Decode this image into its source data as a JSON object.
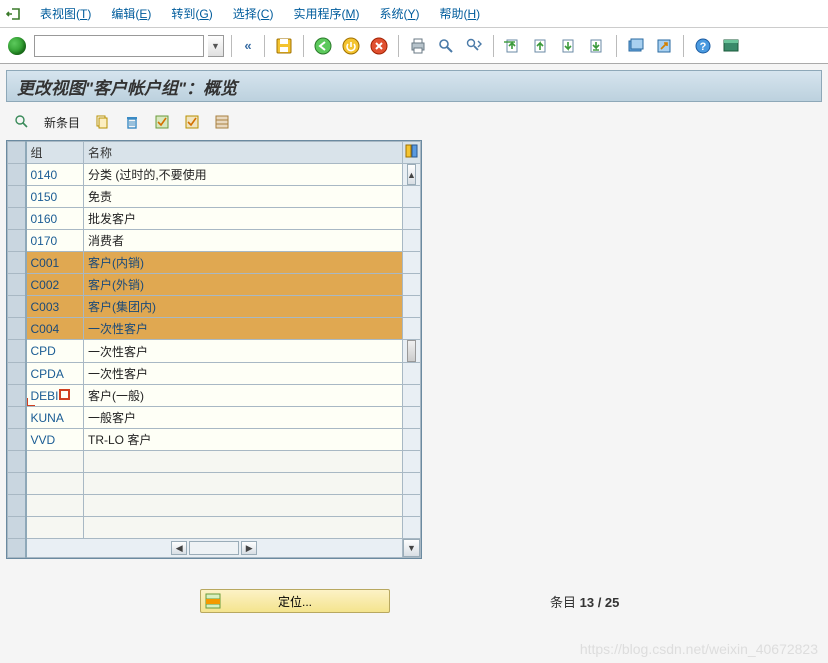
{
  "menu": {
    "items": [
      {
        "label": "表视图",
        "key": "T"
      },
      {
        "label": "编辑",
        "key": "E"
      },
      {
        "label": "转到",
        "key": "G"
      },
      {
        "label": "选择",
        "key": "C"
      },
      {
        "label": "实用程序",
        "key": "M"
      },
      {
        "label": "系统",
        "key": "Y"
      },
      {
        "label": "帮助",
        "key": "H"
      }
    ]
  },
  "toolbar": {
    "okcode_value": "",
    "chevron_label": "«"
  },
  "page_title": "更改视图\"客户帐户组\"：概览",
  "app_toolbar": {
    "new_entries_label": "新条目"
  },
  "table": {
    "columns": {
      "group": "组",
      "name": "名称"
    },
    "rows": [
      {
        "group": "0140",
        "name": "分类 (过时的,不要使用",
        "selected": false
      },
      {
        "group": "0150",
        "name": "免责",
        "selected": false
      },
      {
        "group": "0160",
        "name": "批发客户",
        "selected": false
      },
      {
        "group": "0170",
        "name": "消费者",
        "selected": false
      },
      {
        "group": "C001",
        "name": "客户(内销)",
        "selected": true
      },
      {
        "group": "C002",
        "name": "客户(外销)",
        "selected": true
      },
      {
        "group": "C003",
        "name": "客户(集团内)",
        "selected": true
      },
      {
        "group": "C004",
        "name": "一次性客户",
        "selected": true
      },
      {
        "group": "CPD",
        "name": "一次性客户",
        "selected": false
      },
      {
        "group": "CPDA",
        "name": "一次性客户",
        "selected": false
      },
      {
        "group": "DEBI",
        "name": "客户(一般)",
        "selected": false,
        "cursor": true
      },
      {
        "group": "KUNA",
        "name": "一般客户",
        "selected": false
      },
      {
        "group": "VVD",
        "name": "TR-LO 客户",
        "selected": false
      }
    ]
  },
  "footer": {
    "locate_label": "定位...",
    "status_prefix": "条目 ",
    "status_count": "13 / 25"
  },
  "watermark": "https://blog.csdn.net/weixin_40672823"
}
